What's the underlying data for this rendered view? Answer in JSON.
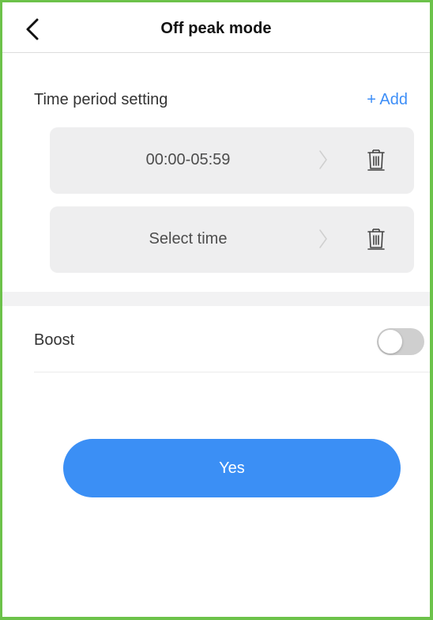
{
  "header": {
    "title": "Off peak mode",
    "back_icon": "chevron-left-icon"
  },
  "time_period": {
    "label": "Time period setting",
    "add_label": "+ Add",
    "slots": [
      {
        "text": "00:00-05:59",
        "chevron_icon": "chevron-right-icon",
        "delete_icon": "trash-icon"
      },
      {
        "text": "Select time",
        "chevron_icon": "chevron-right-icon",
        "delete_icon": "trash-icon"
      }
    ]
  },
  "boost": {
    "label": "Boost",
    "enabled": false
  },
  "actions": {
    "confirm_label": "Yes"
  },
  "colors": {
    "accent": "#3b8ff5",
    "frame_border": "#6cc24a",
    "slot_background": "#eeeeef",
    "toggle_off": "#cfcfcf"
  }
}
